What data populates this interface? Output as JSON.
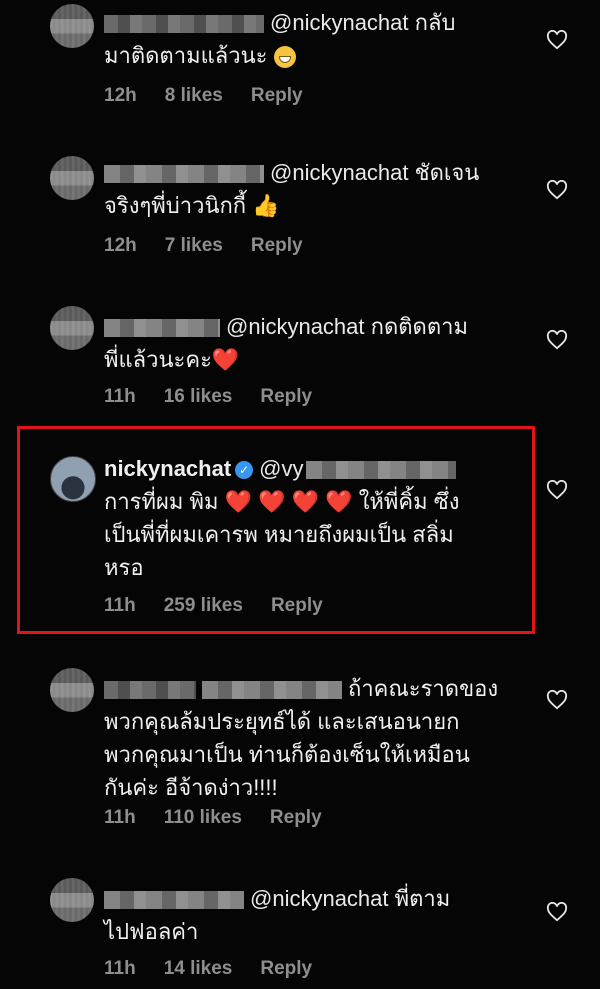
{
  "comments": [
    {
      "mention": "@nickynachat",
      "text_line1": "กลับ",
      "text_line2": "มาติดตามแล้วนะ",
      "emoji": "grinning-face",
      "time": "12h",
      "likes": "8 likes",
      "reply": "Reply"
    },
    {
      "mention": "@nickynachat",
      "text_line1": "ชัดเจน",
      "text_line2": "จริงๆพี่บ่าวนิกกี้",
      "emoji": "thumbs-up",
      "time": "12h",
      "likes": "7 likes",
      "reply": "Reply"
    },
    {
      "mention": "@nickynachat",
      "text_line1": "กดติดตาม",
      "text_line2": "พี่แล้วนะคะ",
      "emoji": "red-heart",
      "time": "11h",
      "likes": "16 likes",
      "reply": "Reply"
    },
    {
      "username": "nickynachat",
      "mention": "@vy",
      "text_line1a": "การที่ผม พิม",
      "text_line1b": "ให้พี่คิ้ม ซึ่ง",
      "text_line2": "เป็นพี่ที่ผมเคารพ หมายถึงผมเป็น สลิ่ม",
      "text_line3": "หรอ",
      "hearts": "❤️ ❤️ ❤️ ❤️",
      "time": "11h",
      "likes": "259 likes",
      "reply": "Reply"
    },
    {
      "text_line1": "ถ้าคณะราดของ",
      "text_line2": "พวกคุณล้มประยุทธ์ได้ และเสนอนายก",
      "text_line3": "พวกคุณมาเป็น ท่านก็ต้องเซ็นให้เหมือน",
      "text_line4": "กันค่ะ  อีจ้าดง่าว!!!!",
      "time": "11h",
      "likes": "110 likes",
      "reply": "Reply"
    },
    {
      "mention": "@nickynachat",
      "text_line1": "พี่ตาม",
      "text_line2": "ไปฟอลค่า",
      "time": "11h",
      "likes": "14 likes",
      "reply": "Reply"
    }
  ],
  "icons": {
    "like": "heart-outline-icon",
    "verified": "verified-badge-icon"
  },
  "colors": {
    "highlight": "#e0141b",
    "verified": "#3897f0",
    "meta": "#8e8e8e"
  }
}
